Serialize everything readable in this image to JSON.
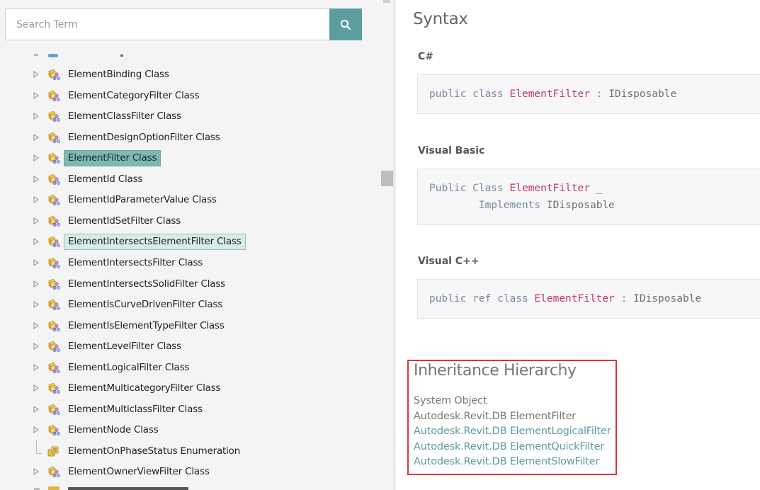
{
  "colors": {
    "accent": "#5a9ea0",
    "selected_bg": "#7fb7b3",
    "hover_bg": "#d6ece9",
    "type_name": "#c5326c",
    "link": "#5b9d9c",
    "highlight_border": "#d9363e"
  },
  "search": {
    "placeholder": "Search Term",
    "value": "",
    "button_icon": "search-icon"
  },
  "tree": {
    "items": [
      {
        "label": "ElementBinding Class",
        "icon": "class-icon",
        "expander": "triangle",
        "state": ""
      },
      {
        "label": "ElementCategoryFilter Class",
        "icon": "class-icon",
        "expander": "triangle",
        "state": ""
      },
      {
        "label": "ElementClassFilter Class",
        "icon": "class-icon",
        "expander": "triangle",
        "state": ""
      },
      {
        "label": "ElementDesignOptionFilter Class",
        "icon": "class-icon",
        "expander": "triangle",
        "state": ""
      },
      {
        "label": "ElementFilter Class",
        "icon": "class-icon",
        "expander": "triangle",
        "state": "selected"
      },
      {
        "label": "ElementId Class",
        "icon": "class-icon",
        "expander": "triangle",
        "state": ""
      },
      {
        "label": "ElementIdParameterValue Class",
        "icon": "class-icon",
        "expander": "triangle",
        "state": ""
      },
      {
        "label": "ElementIdSetFilter Class",
        "icon": "class-icon",
        "expander": "triangle",
        "state": ""
      },
      {
        "label": "ElementIntersectsElementFilter Class",
        "icon": "class-icon",
        "expander": "triangle",
        "state": "hovered"
      },
      {
        "label": "ElementIntersectsFilter Class",
        "icon": "class-icon",
        "expander": "triangle",
        "state": ""
      },
      {
        "label": "ElementIntersectsSolidFilter Class",
        "icon": "class-icon",
        "expander": "triangle",
        "state": ""
      },
      {
        "label": "ElementIsCurveDrivenFilter Class",
        "icon": "class-icon",
        "expander": "triangle",
        "state": ""
      },
      {
        "label": "ElementIsElementTypeFilter Class",
        "icon": "class-icon",
        "expander": "triangle",
        "state": ""
      },
      {
        "label": "ElementLevelFilter Class",
        "icon": "class-icon",
        "expander": "triangle",
        "state": ""
      },
      {
        "label": "ElementLogicalFilter Class",
        "icon": "class-icon",
        "expander": "triangle",
        "state": ""
      },
      {
        "label": "ElementMulticategoryFilter Class",
        "icon": "class-icon",
        "expander": "triangle",
        "state": ""
      },
      {
        "label": "ElementMulticlassFilter Class",
        "icon": "class-icon",
        "expander": "triangle",
        "state": ""
      },
      {
        "label": "ElementNode Class",
        "icon": "class-icon",
        "expander": "triangle",
        "state": ""
      },
      {
        "label": "ElementOnPhaseStatus Enumeration",
        "icon": "enum-icon",
        "expander": "line",
        "state": ""
      },
      {
        "label": "ElementOwnerViewFilter Class",
        "icon": "class-icon",
        "expander": "triangle",
        "state": ""
      }
    ]
  },
  "content": {
    "syntax_heading": "Syntax",
    "csharp": {
      "label": "C#",
      "lines": [
        [
          {
            "t": "public class ",
            "c": "kw"
          },
          {
            "t": "ElementFilter",
            "c": "type"
          },
          {
            "t": " : ",
            "c": "punc"
          },
          {
            "t": "IDisposable",
            "c": "plain"
          }
        ]
      ]
    },
    "vb": {
      "label": "Visual Basic",
      "lines": [
        [
          {
            "t": "Public Class ",
            "c": "kw"
          },
          {
            "t": "ElementFilter",
            "c": "type"
          },
          {
            "t": " _",
            "c": "plain"
          }
        ],
        [
          {
            "t": "\tImplements ",
            "c": "kw"
          },
          {
            "t": "IDisposable",
            "c": "plain"
          }
        ]
      ]
    },
    "cpp": {
      "label": "Visual C++",
      "lines": [
        [
          {
            "t": "public ref class ",
            "c": "kw"
          },
          {
            "t": "ElementFilter",
            "c": "type"
          },
          {
            "t": " : ",
            "c": "punc"
          },
          {
            "t": "IDisposable",
            "c": "plain"
          }
        ]
      ]
    },
    "inheritance": {
      "heading": "Inheritance Hierarchy",
      "items": [
        {
          "text": "System Object",
          "link": false
        },
        {
          "text": "Autodesk.Revit.DB ElementFilter",
          "link": false
        },
        {
          "text": "Autodesk.Revit.DB ElementLogicalFilter",
          "link": true
        },
        {
          "text": "Autodesk.Revit.DB ElementQuickFilter",
          "link": true
        },
        {
          "text": "Autodesk.Revit.DB ElementSlowFilter",
          "link": true
        }
      ]
    }
  }
}
